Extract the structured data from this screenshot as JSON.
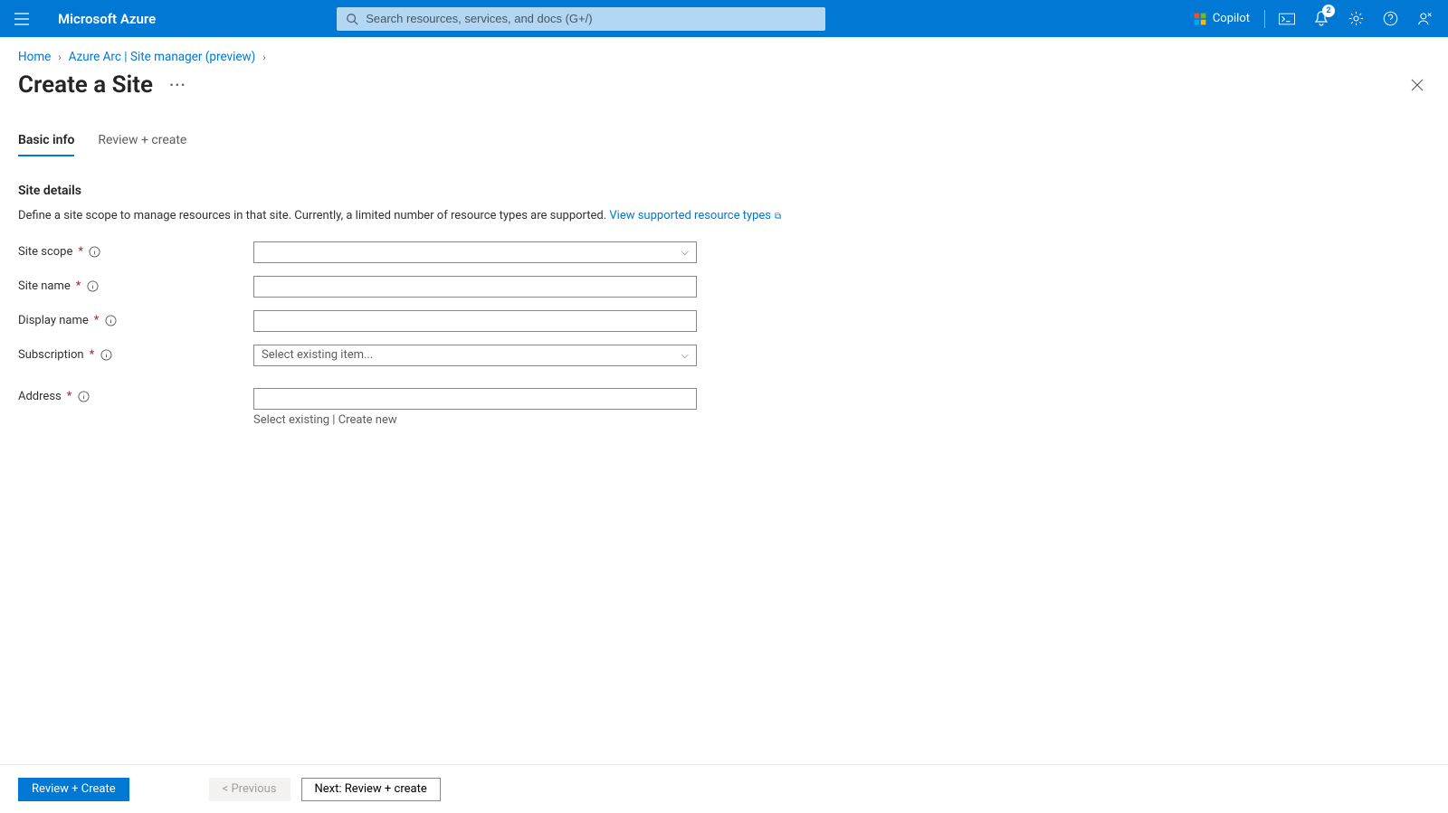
{
  "brand": "Microsoft Azure",
  "search_placeholder": "Search resources, services, and docs (G+/)",
  "copilot_label": "Copilot",
  "notifications_count": "2",
  "breadcrumb": {
    "home": "Home",
    "arc": "Azure Arc | Site manager (preview)"
  },
  "page_title": "Create a Site",
  "tabs": {
    "basic": "Basic info",
    "review": "Review + create"
  },
  "section": {
    "title": "Site details",
    "desc_text": "Define a site scope to manage resources in that site. Currently, a limited number of resource types are supported. ",
    "desc_link": "View supported resource types"
  },
  "fields": {
    "site_scope": {
      "label": "Site scope",
      "value": ""
    },
    "site_name": {
      "label": "Site name",
      "value": ""
    },
    "display_name": {
      "label": "Display name",
      "value": ""
    },
    "subscription": {
      "label": "Subscription",
      "placeholder": "Select existing item...",
      "value": ""
    },
    "address": {
      "label": "Address",
      "value": "",
      "select_existing": "Select existing",
      "create_new": "Create new"
    }
  },
  "footer": {
    "primary": "Review + Create",
    "previous": "< Previous",
    "next": "Next: Review + create"
  }
}
